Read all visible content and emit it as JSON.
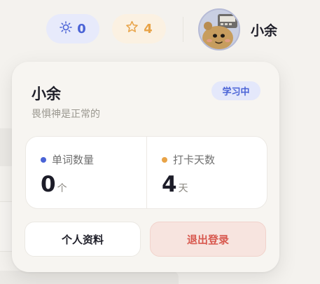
{
  "header": {
    "sun_count": "0",
    "star_count": "4",
    "username": "小余"
  },
  "profile_card": {
    "name": "小余",
    "motto": "畏惧神是正常的",
    "badge": "学习中",
    "stats": [
      {
        "label": "单词数量",
        "value": "0",
        "unit": "个",
        "dot_color": "#4a63d6"
      },
      {
        "label": "打卡天数",
        "value": "4",
        "unit": "天",
        "dot_color": "#e8a347"
      }
    ],
    "profile_button": "个人资料",
    "logout_button": "退出登录"
  },
  "colors": {
    "accent_blue": "#4a63d6",
    "accent_orange": "#e8a347",
    "danger": "#d8594f"
  },
  "icons": [
    "sun-icon",
    "star-icon",
    "avatar"
  ]
}
